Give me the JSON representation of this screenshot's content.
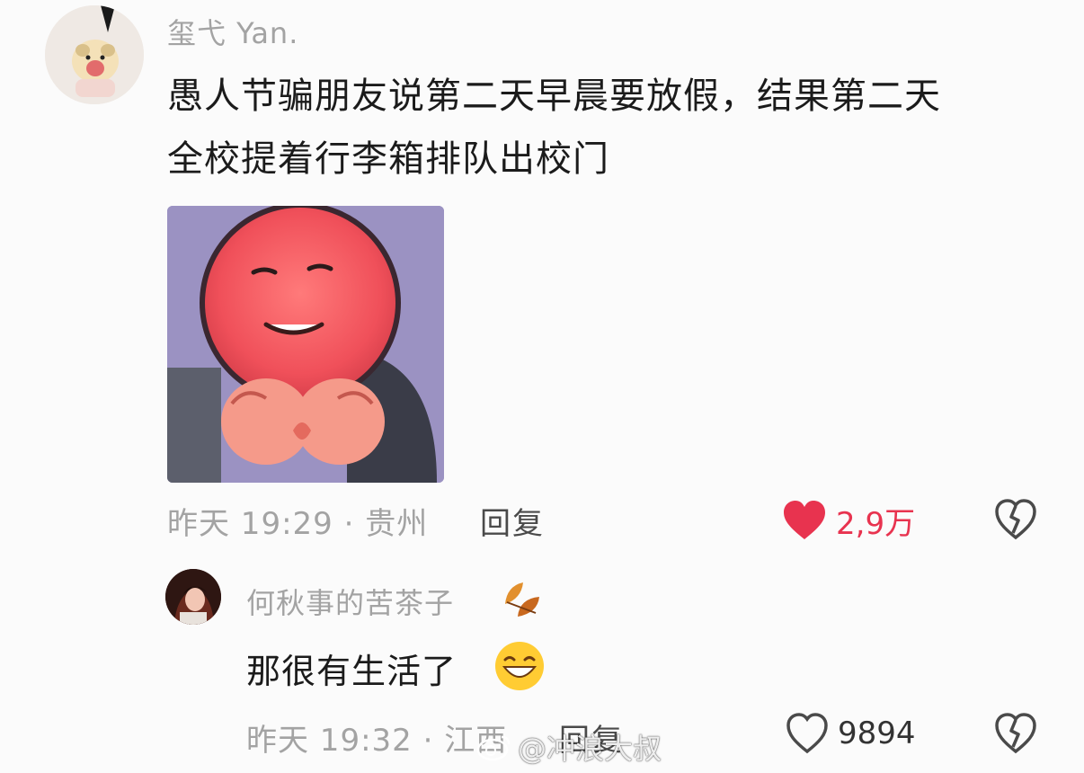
{
  "comment": {
    "username": "玺弋 Yan.",
    "text_line1": "愚人节骗朋友说第二天早晨要放假，结果第二天",
    "text_line2": "全校提着行李箱排队出校门",
    "meta": "昨天 19:29 · 贵州",
    "reply_label": "回复",
    "like_count": "2,9万",
    "liked": true,
    "like_color": "#e8334f"
  },
  "reply_comment": {
    "username": "何秋事的苦茶子",
    "username_icon": "leaf-icon",
    "text": "那很有生活了",
    "text_emoji": "grin-emoji-icon",
    "meta": "昨天 19:32 · 江西",
    "reply_label": "回复",
    "like_count": "9894",
    "liked": false
  },
  "watermark": "@冲浪大叔"
}
